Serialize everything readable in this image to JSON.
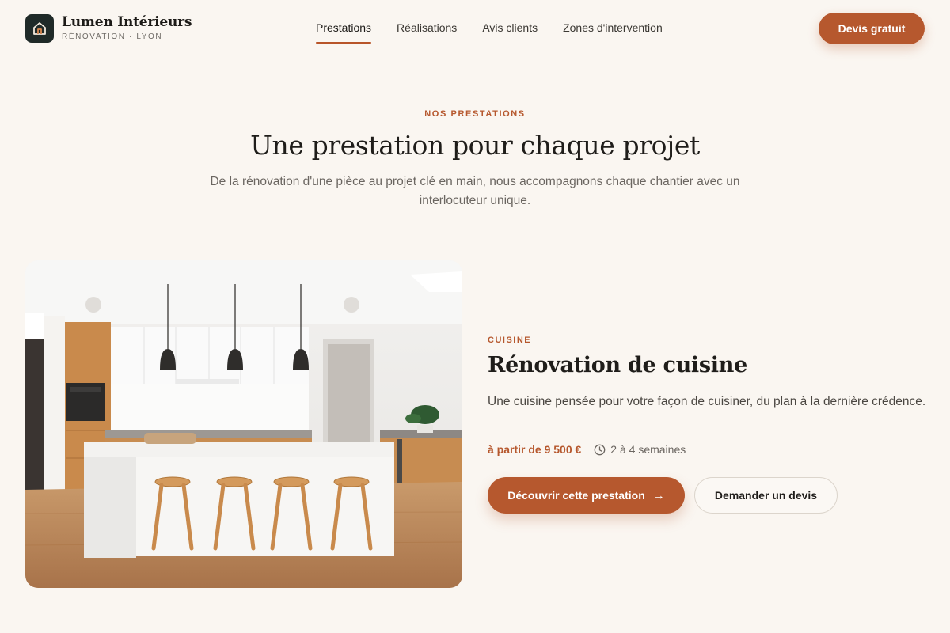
{
  "brand": {
    "name": "Lumen Intérieurs",
    "tagline": "RÉNOVATION · LYON",
    "icon": "house-icon"
  },
  "nav": {
    "items": [
      {
        "label": "Prestations",
        "active": true
      },
      {
        "label": "Réalisations",
        "active": false
      },
      {
        "label": "Avis clients",
        "active": false
      },
      {
        "label": "Zones d'intervention",
        "active": false
      }
    ],
    "cta": "Devis gratuit"
  },
  "section": {
    "eyebrow": "NOS PRESTATIONS",
    "title": "Une prestation pour chaque projet",
    "subtitle": "De la rénovation d'une pièce au projet clé en main, nous accompagnons chaque chantier avec un interlocuteur unique."
  },
  "service": {
    "category": "CUISINE",
    "title": "Rénovation de cuisine",
    "description": "Une cuisine pensée pour votre façon de cuisiner, du plan à la dernière crédence.",
    "price": "à partir de 9 500 €",
    "duration": "2 à 4 semaines",
    "duration_icon": "clock-icon",
    "primary_cta": "Découvrir cette prestation",
    "primary_cta_icon": "arrow-right-icon",
    "secondary_cta": "Demander un devis",
    "image": "kitchen-photo"
  },
  "colors": {
    "accent": "#b6582e",
    "background": "#faf6f1",
    "logo_bg": "#1f2a28"
  }
}
